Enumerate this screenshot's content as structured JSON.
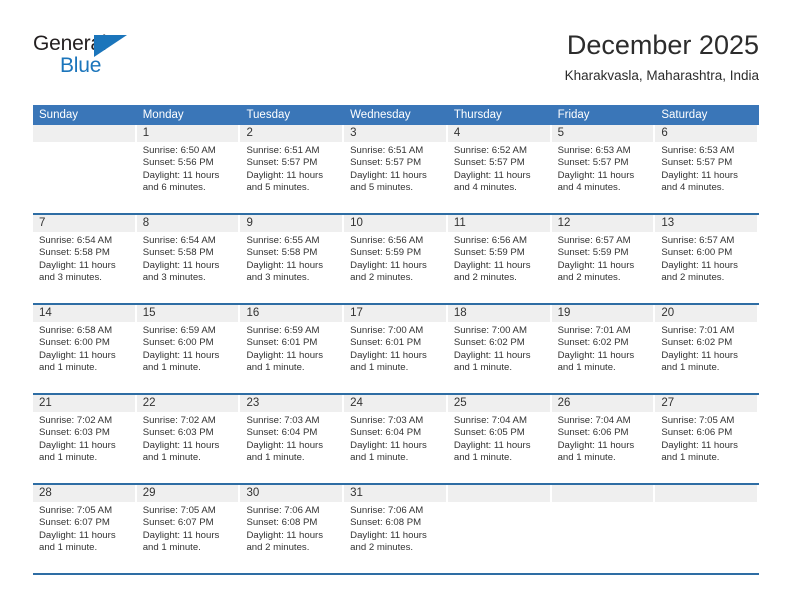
{
  "logo": {
    "text_top": "General",
    "text_bottom": "Blue",
    "triangle_color": "#1b75bb"
  },
  "header": {
    "title": "December 2025",
    "subtitle": "Kharakvasla, Maharashtra, India"
  },
  "theme": {
    "header_blue": "#3a76b8",
    "rule_blue": "#2e6da4",
    "day_band_gray": "#efefef"
  },
  "calendar": {
    "weekday_headers": [
      "Sunday",
      "Monday",
      "Tuesday",
      "Wednesday",
      "Thursday",
      "Friday",
      "Saturday"
    ],
    "weeks": [
      [
        {
          "day": "",
          "sunrise": "",
          "sunset": "",
          "daylight": ""
        },
        {
          "day": "1",
          "sunrise": "Sunrise: 6:50 AM",
          "sunset": "Sunset: 5:56 PM",
          "daylight": "Daylight: 11 hours and 6 minutes."
        },
        {
          "day": "2",
          "sunrise": "Sunrise: 6:51 AM",
          "sunset": "Sunset: 5:57 PM",
          "daylight": "Daylight: 11 hours and 5 minutes."
        },
        {
          "day": "3",
          "sunrise": "Sunrise: 6:51 AM",
          "sunset": "Sunset: 5:57 PM",
          "daylight": "Daylight: 11 hours and 5 minutes."
        },
        {
          "day": "4",
          "sunrise": "Sunrise: 6:52 AM",
          "sunset": "Sunset: 5:57 PM",
          "daylight": "Daylight: 11 hours and 4 minutes."
        },
        {
          "day": "5",
          "sunrise": "Sunrise: 6:53 AM",
          "sunset": "Sunset: 5:57 PM",
          "daylight": "Daylight: 11 hours and 4 minutes."
        },
        {
          "day": "6",
          "sunrise": "Sunrise: 6:53 AM",
          "sunset": "Sunset: 5:57 PM",
          "daylight": "Daylight: 11 hours and 4 minutes."
        }
      ],
      [
        {
          "day": "7",
          "sunrise": "Sunrise: 6:54 AM",
          "sunset": "Sunset: 5:58 PM",
          "daylight": "Daylight: 11 hours and 3 minutes."
        },
        {
          "day": "8",
          "sunrise": "Sunrise: 6:54 AM",
          "sunset": "Sunset: 5:58 PM",
          "daylight": "Daylight: 11 hours and 3 minutes."
        },
        {
          "day": "9",
          "sunrise": "Sunrise: 6:55 AM",
          "sunset": "Sunset: 5:58 PM",
          "daylight": "Daylight: 11 hours and 3 minutes."
        },
        {
          "day": "10",
          "sunrise": "Sunrise: 6:56 AM",
          "sunset": "Sunset: 5:59 PM",
          "daylight": "Daylight: 11 hours and 2 minutes."
        },
        {
          "day": "11",
          "sunrise": "Sunrise: 6:56 AM",
          "sunset": "Sunset: 5:59 PM",
          "daylight": "Daylight: 11 hours and 2 minutes."
        },
        {
          "day": "12",
          "sunrise": "Sunrise: 6:57 AM",
          "sunset": "Sunset: 5:59 PM",
          "daylight": "Daylight: 11 hours and 2 minutes."
        },
        {
          "day": "13",
          "sunrise": "Sunrise: 6:57 AM",
          "sunset": "Sunset: 6:00 PM",
          "daylight": "Daylight: 11 hours and 2 minutes."
        }
      ],
      [
        {
          "day": "14",
          "sunrise": "Sunrise: 6:58 AM",
          "sunset": "Sunset: 6:00 PM",
          "daylight": "Daylight: 11 hours and 1 minute."
        },
        {
          "day": "15",
          "sunrise": "Sunrise: 6:59 AM",
          "sunset": "Sunset: 6:00 PM",
          "daylight": "Daylight: 11 hours and 1 minute."
        },
        {
          "day": "16",
          "sunrise": "Sunrise: 6:59 AM",
          "sunset": "Sunset: 6:01 PM",
          "daylight": "Daylight: 11 hours and 1 minute."
        },
        {
          "day": "17",
          "sunrise": "Sunrise: 7:00 AM",
          "sunset": "Sunset: 6:01 PM",
          "daylight": "Daylight: 11 hours and 1 minute."
        },
        {
          "day": "18",
          "sunrise": "Sunrise: 7:00 AM",
          "sunset": "Sunset: 6:02 PM",
          "daylight": "Daylight: 11 hours and 1 minute."
        },
        {
          "day": "19",
          "sunrise": "Sunrise: 7:01 AM",
          "sunset": "Sunset: 6:02 PM",
          "daylight": "Daylight: 11 hours and 1 minute."
        },
        {
          "day": "20",
          "sunrise": "Sunrise: 7:01 AM",
          "sunset": "Sunset: 6:02 PM",
          "daylight": "Daylight: 11 hours and 1 minute."
        }
      ],
      [
        {
          "day": "21",
          "sunrise": "Sunrise: 7:02 AM",
          "sunset": "Sunset: 6:03 PM",
          "daylight": "Daylight: 11 hours and 1 minute."
        },
        {
          "day": "22",
          "sunrise": "Sunrise: 7:02 AM",
          "sunset": "Sunset: 6:03 PM",
          "daylight": "Daylight: 11 hours and 1 minute."
        },
        {
          "day": "23",
          "sunrise": "Sunrise: 7:03 AM",
          "sunset": "Sunset: 6:04 PM",
          "daylight": "Daylight: 11 hours and 1 minute."
        },
        {
          "day": "24",
          "sunrise": "Sunrise: 7:03 AM",
          "sunset": "Sunset: 6:04 PM",
          "daylight": "Daylight: 11 hours and 1 minute."
        },
        {
          "day": "25",
          "sunrise": "Sunrise: 7:04 AM",
          "sunset": "Sunset: 6:05 PM",
          "daylight": "Daylight: 11 hours and 1 minute."
        },
        {
          "day": "26",
          "sunrise": "Sunrise: 7:04 AM",
          "sunset": "Sunset: 6:06 PM",
          "daylight": "Daylight: 11 hours and 1 minute."
        },
        {
          "day": "27",
          "sunrise": "Sunrise: 7:05 AM",
          "sunset": "Sunset: 6:06 PM",
          "daylight": "Daylight: 11 hours and 1 minute."
        }
      ],
      [
        {
          "day": "28",
          "sunrise": "Sunrise: 7:05 AM",
          "sunset": "Sunset: 6:07 PM",
          "daylight": "Daylight: 11 hours and 1 minute."
        },
        {
          "day": "29",
          "sunrise": "Sunrise: 7:05 AM",
          "sunset": "Sunset: 6:07 PM",
          "daylight": "Daylight: 11 hours and 1 minute."
        },
        {
          "day": "30",
          "sunrise": "Sunrise: 7:06 AM",
          "sunset": "Sunset: 6:08 PM",
          "daylight": "Daylight: 11 hours and 2 minutes."
        },
        {
          "day": "31",
          "sunrise": "Sunrise: 7:06 AM",
          "sunset": "Sunset: 6:08 PM",
          "daylight": "Daylight: 11 hours and 2 minutes."
        },
        {
          "day": "",
          "sunrise": "",
          "sunset": "",
          "daylight": ""
        },
        {
          "day": "",
          "sunrise": "",
          "sunset": "",
          "daylight": ""
        },
        {
          "day": "",
          "sunrise": "",
          "sunset": "",
          "daylight": ""
        }
      ]
    ]
  }
}
